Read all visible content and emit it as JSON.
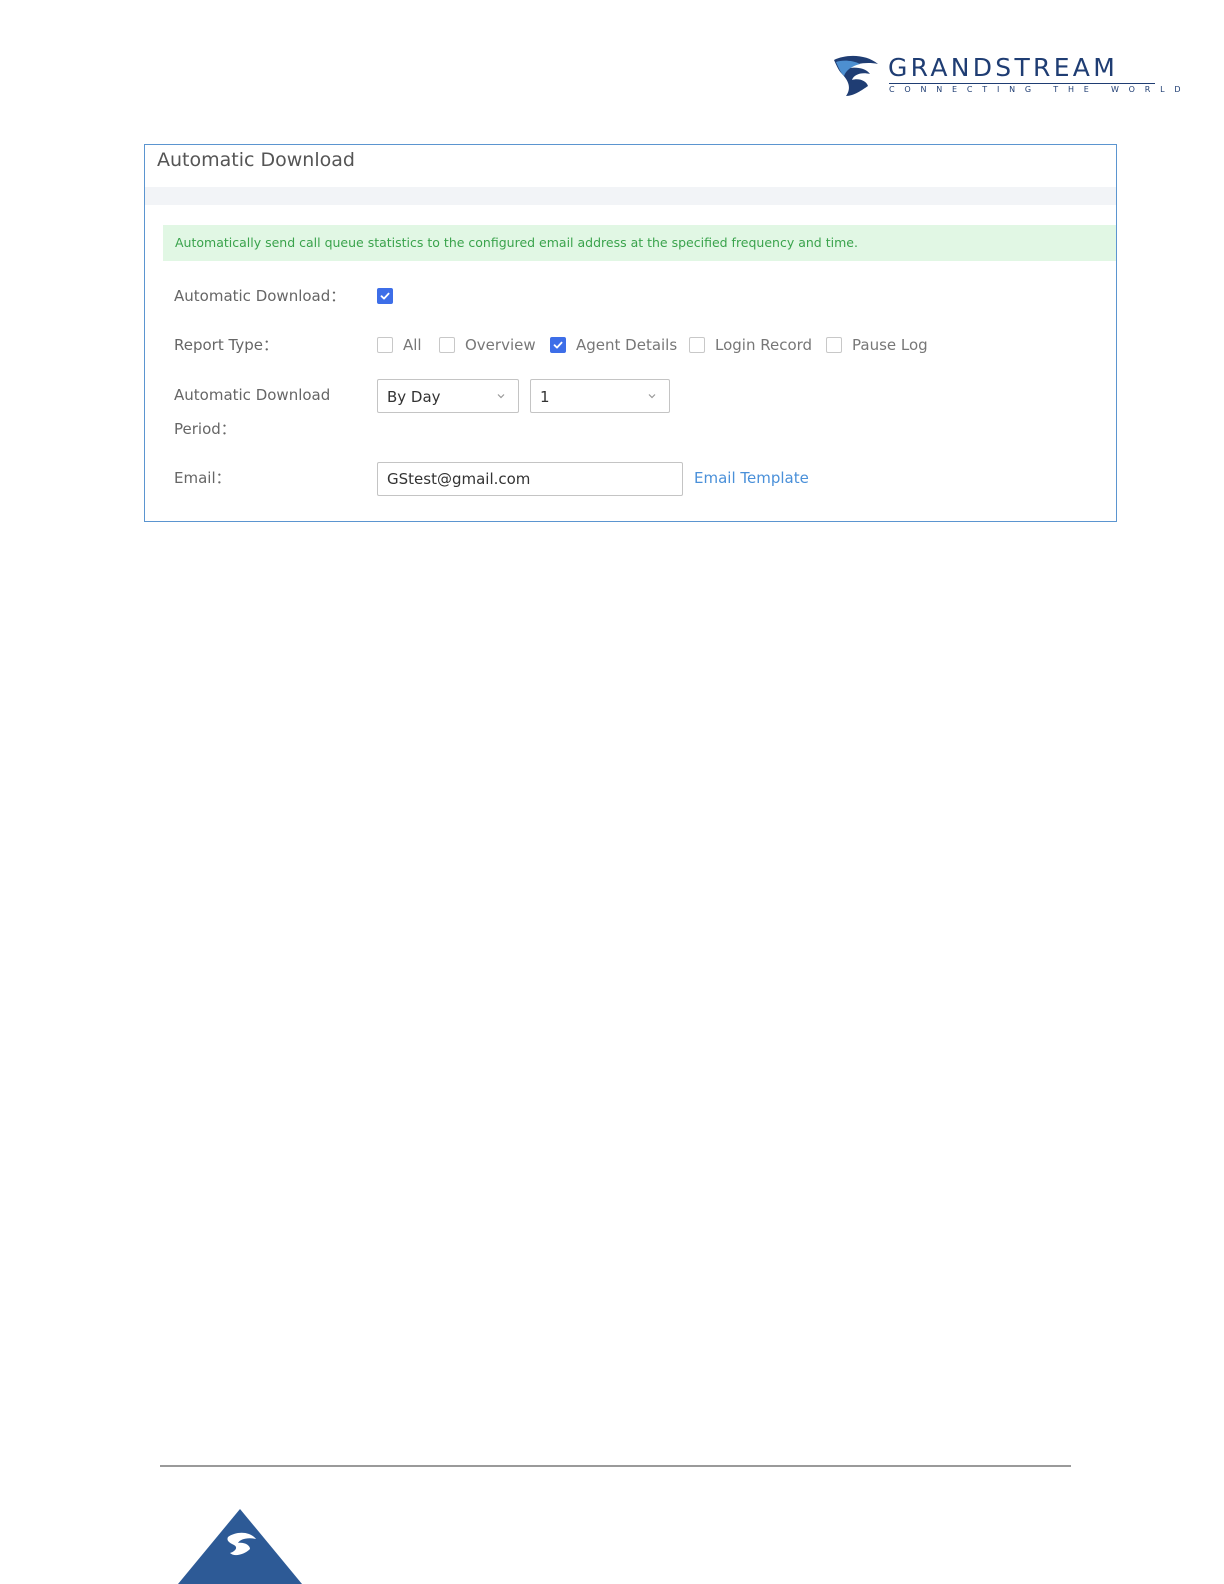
{
  "header": {
    "logo_word": "GRANDSTREAM",
    "logo_tagline": "CONNECTING THE WORLD",
    "logo_icon": "grandstream-logo-icon"
  },
  "panel": {
    "title": "Automatic Download",
    "notice": "Automatically send call queue statistics to the configured email address at the specified frequency and time.",
    "automatic_download": {
      "label": "Automatic Download：",
      "checked": true
    },
    "report_type": {
      "label": "Report Type：",
      "options": [
        {
          "label": "All",
          "checked": false
        },
        {
          "label": "Overview",
          "checked": false
        },
        {
          "label": "Agent Details",
          "checked": true
        },
        {
          "label": "Login Record",
          "checked": false
        },
        {
          "label": "Pause Log",
          "checked": false
        }
      ]
    },
    "period": {
      "label_line1": "Automatic Download",
      "label_line2": "Period：",
      "frequency": "By Day",
      "value": "1"
    },
    "email": {
      "label": "Email：",
      "value": "GStest@gmail.com",
      "template_link": "Email Template"
    }
  },
  "colors": {
    "accent": "#3d6ee8",
    "panel_border": "#5b95d0",
    "notice_bg": "#e1f7e4",
    "notice_text": "#3aa34c",
    "link": "#4a90d9",
    "brand": "#1f3d73"
  }
}
